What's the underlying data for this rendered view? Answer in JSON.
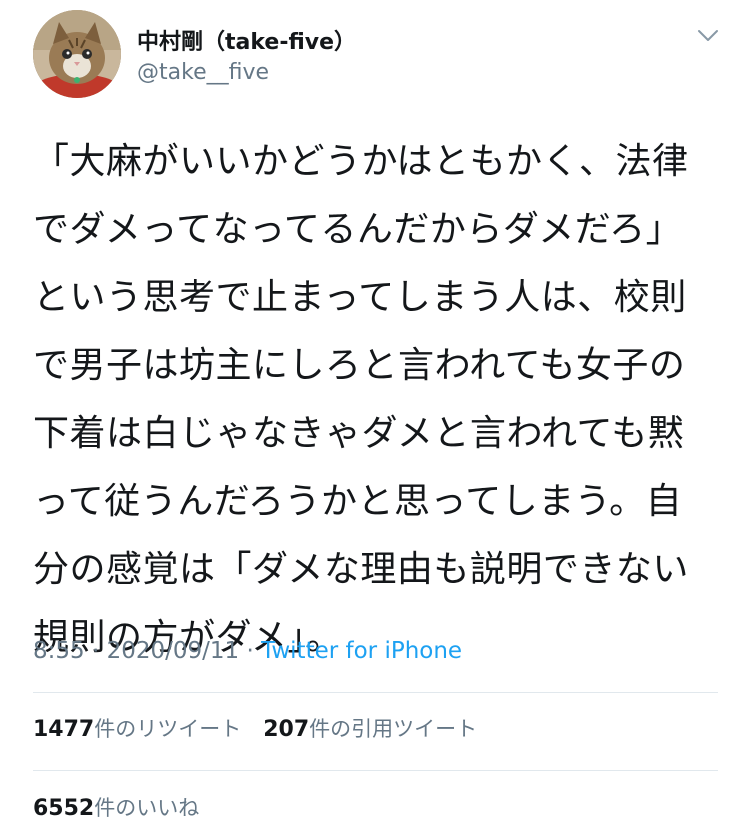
{
  "user": {
    "display_name": "中村剛（take-five）",
    "handle": "@take__five",
    "avatar": "cat-avatar"
  },
  "tweet": {
    "lines": [
      "「大麻がいいかどうかはともかく、法律",
      "でダメってなってるんだからダメだろ」",
      "という思考で止まってしまう人は、校則",
      "で男子は坊主にしろと言われても女子の",
      "下着は白じゃなきゃダメと言われても黙",
      "って従うんだろうかと思ってしまう。自",
      "分の感覚は「ダメな理由も説明できない",
      "規則の方がダメ」。"
    ]
  },
  "meta": {
    "time": "8:55",
    "sep1": " · ",
    "date": "2020/09/11",
    "sep2": " · ",
    "source": "Twitter for iPhone"
  },
  "stats": {
    "retweets_count": "1477",
    "retweets_label": "件のリツイート",
    "quotes_count": "207",
    "quotes_label": "件の引用ツイート",
    "likes_count": "6552",
    "likes_label": "件のいいね"
  },
  "icons": {
    "menu": "chevron-down-icon"
  },
  "colors": {
    "text": "#14171a",
    "secondary": "#657786",
    "link": "#1da1f2",
    "divider": "#e1e8ed"
  }
}
